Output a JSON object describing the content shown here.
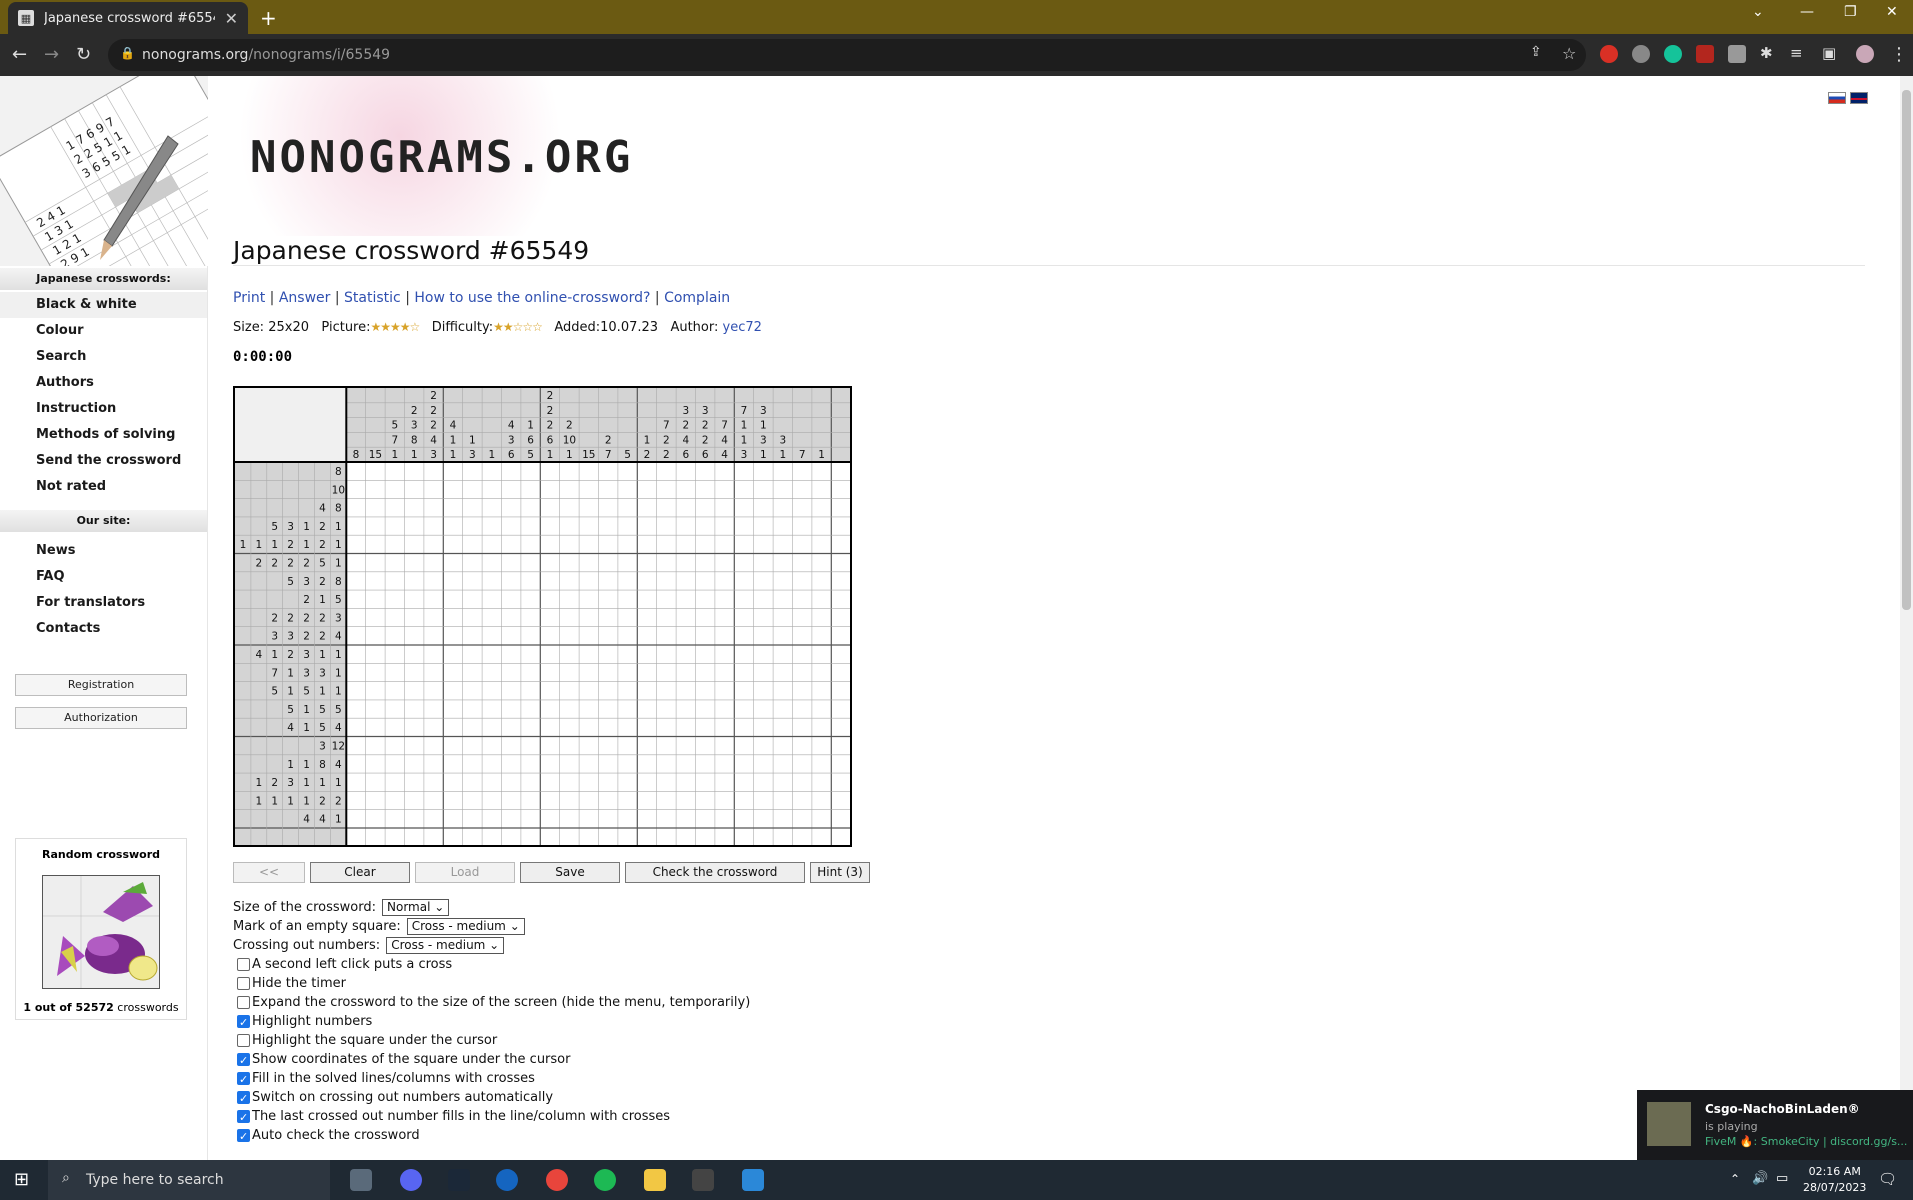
{
  "browser": {
    "tab_title": "Japanese crossword #65549",
    "url_host": "nonograms.org",
    "url_path": "/nonograms/i/65549"
  },
  "site": {
    "logo": "NONOGRAMS.ORG"
  },
  "sidebar": {
    "crosswords_heading": "Japanese crosswords:",
    "crosswords_items": [
      "Black & white",
      "Colour",
      "Search",
      "Authors",
      "Instruction",
      "Methods of solving",
      "Send the crossword",
      "Not rated"
    ],
    "site_heading": "Our site:",
    "site_items": [
      "News",
      "FAQ",
      "For translators",
      "Contacts"
    ],
    "registration": "Registration",
    "authorization": "Authorization",
    "random_title": "Random crossword",
    "random_count_bold": "1 out of 52572",
    "random_count_rest": "crosswords"
  },
  "main": {
    "title": "Japanese crossword #65549",
    "links": [
      "Print",
      "Answer",
      "Statistic",
      "How to use the online-crossword?",
      "Complain"
    ],
    "size_label": "Size:",
    "size": "25x20",
    "picture_label": "Picture:",
    "picture_stars": "★★★★☆",
    "difficulty_label": "Difficulty:",
    "difficulty_stars": "★★☆☆☆",
    "added_label": "Added:",
    "added": "10.07.23",
    "author_label": "Author:",
    "author": "yec72",
    "timer": "0:00:00"
  },
  "puzzle": {
    "cols": 25,
    "rows": 20,
    "column_clues": [
      [
        "8"
      ],
      [
        "15"
      ],
      [
        "5",
        "7",
        "1"
      ],
      [
        "2",
        "3",
        "8",
        "1"
      ],
      [
        "2",
        "2",
        "2",
        "4",
        "3"
      ],
      [
        "4",
        "1",
        "1"
      ],
      [
        "1",
        "3"
      ],
      [
        "1"
      ],
      [
        "4",
        "3",
        "6"
      ],
      [
        "1",
        "6",
        "5"
      ],
      [
        "2",
        "2",
        "2",
        "6",
        "1"
      ],
      [
        "2",
        "10",
        "1"
      ],
      [
        "15"
      ],
      [
        "2",
        "7"
      ],
      [
        "5"
      ],
      [
        "1",
        "2"
      ],
      [
        "7",
        "2",
        "2"
      ],
      [
        "3",
        "2",
        "4",
        "6"
      ],
      [
        "3",
        "2",
        "2",
        "6"
      ],
      [
        "7",
        "4",
        "4"
      ],
      [
        "7",
        "1",
        "1",
        "3"
      ],
      [
        "3",
        "1",
        "3",
        "1"
      ],
      [
        "3",
        "1"
      ],
      [
        "7"
      ],
      [
        "1"
      ]
    ],
    "row_clues": [
      [
        "8"
      ],
      [
        "10"
      ],
      [
        "4",
        "8"
      ],
      [
        "5",
        "3",
        "1",
        "2",
        "1"
      ],
      [
        "1",
        "1",
        "1",
        "2",
        "1",
        "2",
        "1"
      ],
      [
        "2",
        "2",
        "2",
        "2",
        "5",
        "1"
      ],
      [
        "5",
        "3",
        "2",
        "8"
      ],
      [
        "2",
        "1",
        "5"
      ],
      [
        "2",
        "2",
        "2",
        "2",
        "3"
      ],
      [
        "3",
        "3",
        "2",
        "2",
        "4"
      ],
      [
        "4",
        "1",
        "2",
        "3",
        "1",
        "1"
      ],
      [
        "7",
        "1",
        "3",
        "3",
        "1"
      ],
      [
        "5",
        "1",
        "5",
        "1",
        "1"
      ],
      [
        "5",
        "1",
        "5",
        "5"
      ],
      [
        "4",
        "1",
        "5",
        "4"
      ],
      [
        "3",
        "12"
      ],
      [
        "1",
        "1",
        "8",
        "4"
      ],
      [
        "1",
        "2",
        "3",
        "1",
        "1",
        "1"
      ],
      [
        "1",
        "1",
        "1",
        "1",
        "2",
        "2"
      ],
      [
        "4",
        "4",
        "1"
      ]
    ]
  },
  "buttons": {
    "back": "<<",
    "clear": "Clear",
    "load": "Load",
    "save": "Save",
    "check": "Check the crossword",
    "hint": "Hint (3)"
  },
  "settings": {
    "size_label": "Size of the crossword:",
    "size_value": "Normal",
    "mark_label": "Mark of an empty square:",
    "mark_value": "Cross - medium",
    "crossing_label": "Crossing out numbers:",
    "crossing_value": "Cross - medium",
    "checkboxes": [
      {
        "label": "A second left click puts a cross",
        "checked": false
      },
      {
        "label": "Hide the timer",
        "checked": false
      },
      {
        "label": "Expand the crossword to the size of the screen (hide the menu, temporarily)",
        "checked": false
      },
      {
        "label": "Highlight numbers",
        "checked": true
      },
      {
        "label": "Highlight the square under the cursor",
        "checked": false
      },
      {
        "label": "Show coordinates of the square under the cursor",
        "checked": true
      },
      {
        "label": "Fill in the solved lines/columns with crosses",
        "checked": true
      },
      {
        "label": "Switch on crossing out numbers automatically",
        "checked": true
      },
      {
        "label": "The last crossed out number fills in the line/column with crosses",
        "checked": true
      },
      {
        "label": "Auto check the crossword",
        "checked": true
      }
    ]
  },
  "notification": {
    "name": "Csgo-NachoBinLaden®",
    "status": "is playing",
    "game": "FiveM 🔥: SmokeCity  |  discord.gg/s..."
  },
  "taskbar": {
    "search_placeholder": "Type here to search",
    "time": "02:16 AM",
    "date": "28/07/2023"
  }
}
